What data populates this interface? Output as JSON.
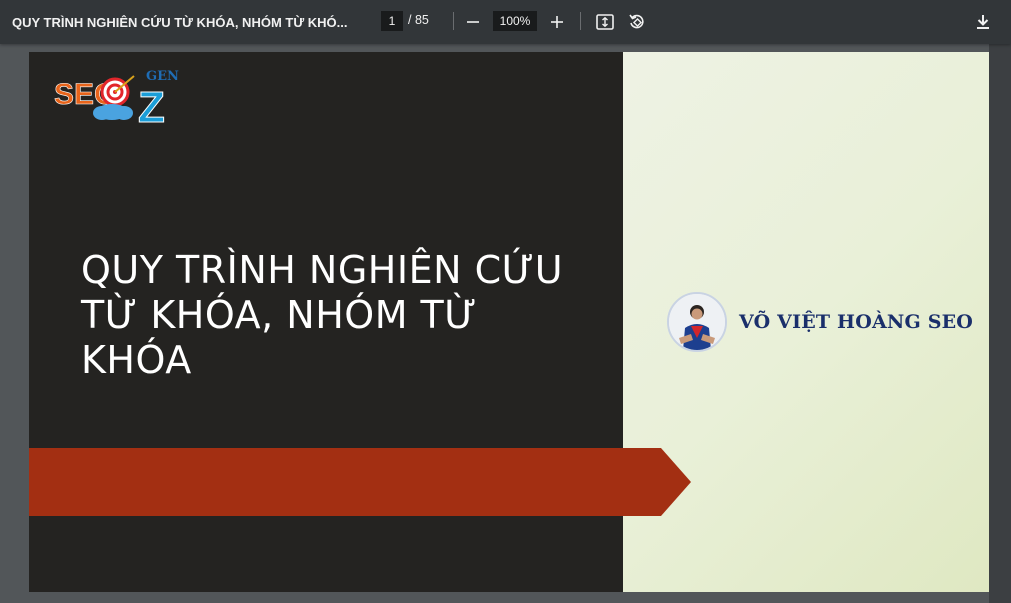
{
  "toolbar": {
    "title": "QUY TRÌNH NGHIÊN CỨU TỪ KHÓA, NHÓM TỪ KHÓ...",
    "current_page": "1",
    "page_total": "/ 85",
    "zoom": "100%",
    "icons": [
      "minus-icon",
      "plus-icon",
      "fit-page-icon",
      "rotate-icon",
      "download-icon"
    ]
  },
  "slide": {
    "logo": {
      "text_seo": "SEO",
      "text_gen": "GEN",
      "text_z": "Z"
    },
    "title_lines": [
      "QUY TRÌNH NGHIÊN CỨU",
      "TỪ KHÓA, NHÓM TỪ",
      "KHÓA"
    ],
    "author": "VÕ VIỆT HOÀNG SEO",
    "colors": {
      "left_bg": "#242321",
      "ribbon": "#a32f12",
      "right_bg": "#e9f0d8",
      "author_text": "#1a2f6b"
    }
  }
}
